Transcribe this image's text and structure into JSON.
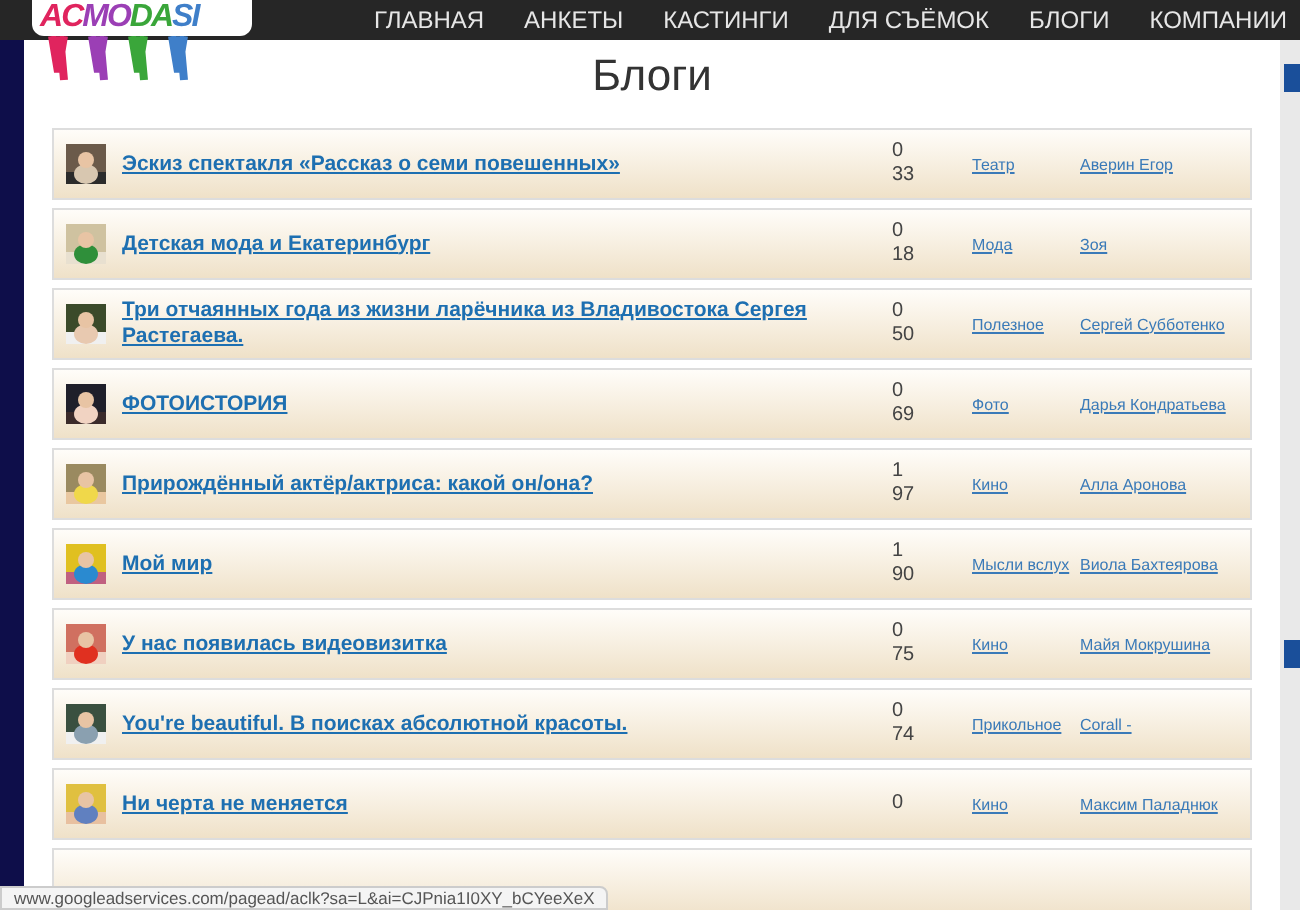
{
  "logo": {
    "letters": [
      {
        "char": "A",
        "color": "#e0245e"
      },
      {
        "char": "C",
        "color": "#e0245e"
      },
      {
        "char": "M",
        "color": "#9b3fb5"
      },
      {
        "char": "O",
        "color": "#9b3fb5"
      },
      {
        "char": "D",
        "color": "#3aa63a"
      },
      {
        "char": "A",
        "color": "#3aa63a"
      },
      {
        "char": "S",
        "color": "#3f7fc9"
      },
      {
        "char": "I",
        "color": "#3f7fc9"
      }
    ]
  },
  "nav": [
    {
      "label": "ГЛАВНАЯ"
    },
    {
      "label": "АНКЕТЫ"
    },
    {
      "label": "КАСТИНГИ"
    },
    {
      "label": "ДЛЯ СЪЁМОК"
    },
    {
      "label": "БЛОГИ"
    },
    {
      "label": "КОМПАНИИ"
    }
  ],
  "page_title": "Блоги",
  "blogs": [
    {
      "title": "Эскиз спектакля «Рассказ о семи повешенных»",
      "count_1": "0",
      "count_2": "33",
      "category": "Театр",
      "author": "Аверин Егор"
    },
    {
      "title": "Детская мода и Екатеринбург",
      "count_1": "0",
      "count_2": "18",
      "category": "Мода",
      "author": "Зоя"
    },
    {
      "title": "Три отчаянных года из жизни ларёчника из Владивостока Сергея Растегаева.",
      "count_1": "0",
      "count_2": "50",
      "category": "Полезное",
      "author": "Сергей Субботенко"
    },
    {
      "title": "ФОТОИСТОРИЯ",
      "count_1": "0",
      "count_2": "69",
      "category": "Фото",
      "author": "Дарья Кондратьева"
    },
    {
      "title": "Прирождённый актёр/актриса: какой он/она?",
      "count_1": "1",
      "count_2": "97",
      "category": "Кино",
      "author": "Алла Аронова"
    },
    {
      "title": "Мой мир",
      "count_1": "1",
      "count_2": "90",
      "category": "Мысли вслух",
      "author": "Виола Бахтеярова"
    },
    {
      "title": "У нас появилась видеовизитка",
      "count_1": "0",
      "count_2": "75",
      "category": "Кино",
      "author": "Майя Мокрушина"
    },
    {
      "title": "You're beautiful. В поисках абсолютной красоты.",
      "count_1": "0",
      "count_2": "74",
      "category": "Прикольное",
      "author": "Corall -"
    },
    {
      "title": "Ни черта не меняется",
      "count_1": "0",
      "category": "Кино",
      "author": "Максим Паладнюк"
    }
  ],
  "status_url": "www.googleadservices.com/pagead/aclk?sa=L&ai=CJPnia1I0XY_bCYeeXeX"
}
